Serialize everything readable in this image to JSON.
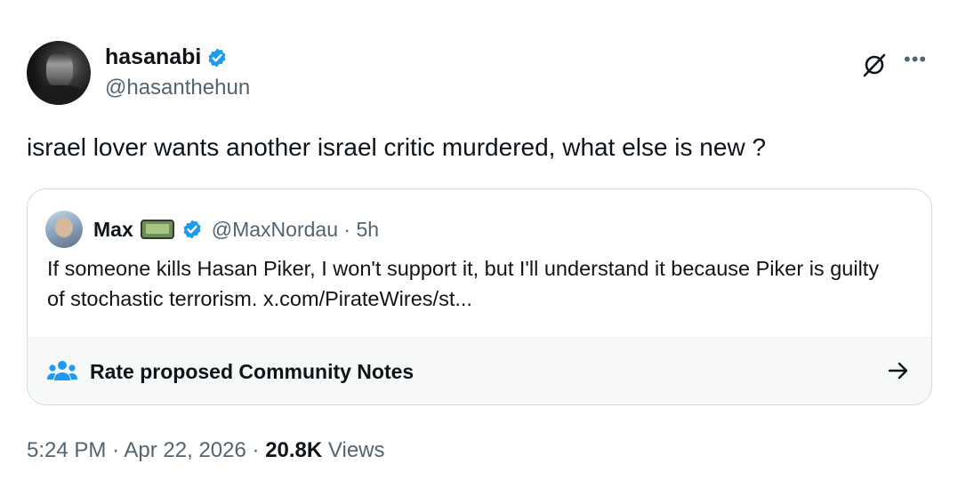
{
  "author": {
    "display_name": "hasanabi",
    "handle": "@hasanthehun"
  },
  "tweet": {
    "text": "israel lover wants another israel critic murdered, what else is new ?"
  },
  "quoted": {
    "display_name": "Max",
    "pager_text": "40404",
    "handle": "@MaxNordau",
    "separator": "·",
    "age": "5h",
    "text": "If someone kills Hasan Piker, I won't support it, but I'll understand it because Piker is guilty of stochastic terrorism. x.com/PirateWires/st..."
  },
  "community_notes": {
    "label": "Rate proposed Community Notes"
  },
  "meta": {
    "time": "5:24 PM",
    "sep1": "·",
    "date": "Apr 22, 2026",
    "sep2": "·",
    "views_count": "20.8K",
    "views_label": "Views"
  },
  "icons": {
    "verified": "verified-badge-icon",
    "grok": "grok-icon",
    "more": "more-icon",
    "community_notes": "people-icon",
    "arrow": "arrow-right-icon"
  },
  "colors": {
    "verified_blue": "#1d9bf0",
    "text_primary": "#0f1419",
    "text_secondary": "#536471",
    "border": "#cfd9de"
  }
}
